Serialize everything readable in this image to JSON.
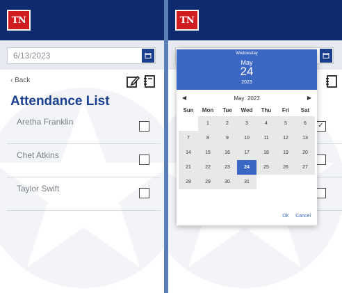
{
  "left": {
    "logo": "TN",
    "date_value": "6/13/2023",
    "back_label": "Back",
    "title": "Attendance List",
    "attendees": [
      {
        "name": "Aretha Franklin",
        "checked": false
      },
      {
        "name": "Chet Atkins",
        "checked": false
      },
      {
        "name": "Taylor Swift",
        "checked": false
      }
    ]
  },
  "right": {
    "logo": "TN",
    "checkboxes": [
      {
        "checked": true
      },
      {
        "checked": false
      },
      {
        "checked": false
      }
    ],
    "calendar": {
      "weekday": "Wednesday",
      "month": "May",
      "day": "24",
      "year": "2023",
      "nav_label": "May  2023",
      "weekdays": [
        "Sun",
        "Mon",
        "Tue",
        "Wed",
        "Thu",
        "Fri",
        "Sat"
      ],
      "leading_blanks": 1,
      "days": [
        "1",
        "2",
        "3",
        "4",
        "5",
        "6",
        "7",
        "8",
        "9",
        "10",
        "11",
        "12",
        "13",
        "14",
        "15",
        "16",
        "17",
        "18",
        "19",
        "20",
        "21",
        "22",
        "23",
        "24",
        "25",
        "26",
        "27",
        "28",
        "29",
        "30",
        "31"
      ],
      "selected_day": "24",
      "ok_label": "Ok",
      "cancel_label": "Cancel"
    }
  },
  "colors": {
    "topbar": "#0d2b6e",
    "accent": "#3a68c4",
    "logo_red": "#d01c1f",
    "divider": "#5a7fb8"
  }
}
